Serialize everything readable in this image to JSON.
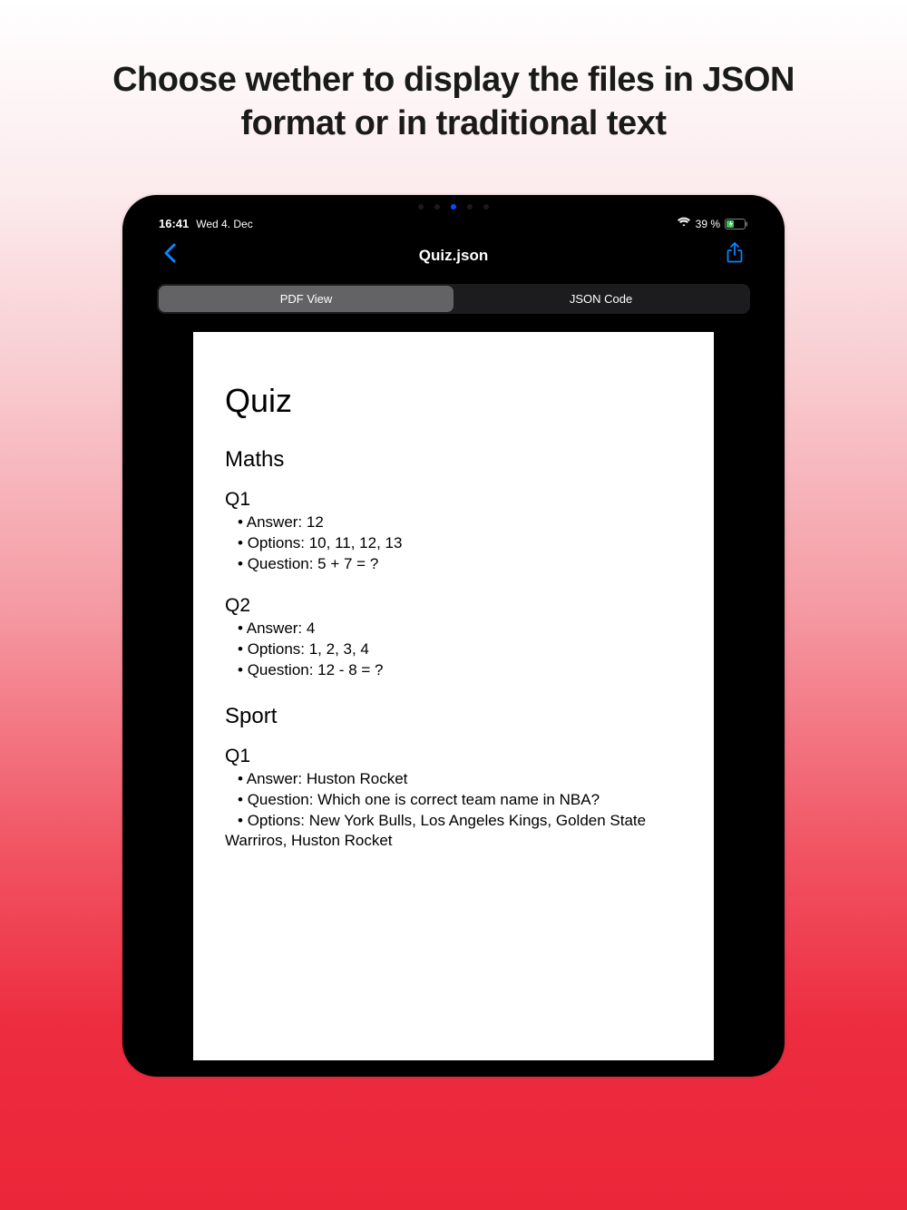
{
  "headline": "Choose wether to display the files in JSON format or in traditional text",
  "statusBar": {
    "time": "16:41",
    "date": "Wed 4. Dec",
    "battery": "39 %"
  },
  "navBar": {
    "title": "Quiz.json"
  },
  "segments": {
    "pdfView": "PDF View",
    "jsonCode": "JSON Code"
  },
  "pdf": {
    "title": "Quiz",
    "sections": {
      "maths": {
        "title": "Maths",
        "q1": {
          "label": "Q1",
          "answer": "Answer: 12",
          "options": "Options: 10, 11, 12, 13",
          "question": "Question: 5 + 7 = ?"
        },
        "q2": {
          "label": "Q2",
          "answer": "Answer: 4",
          "options": "Options: 1, 2, 3, 4",
          "question": "Question: 12 - 8 = ?"
        }
      },
      "sport": {
        "title": "Sport",
        "q1": {
          "label": "Q1",
          "answer": "Answer: Huston Rocket",
          "question": "Question: Which one is correct team name in NBA?",
          "optionsLine1": "Options: New York Bulls, Los Angeles Kings, Golden State",
          "optionsLine2": "Warriros, Huston Rocket"
        }
      }
    }
  }
}
